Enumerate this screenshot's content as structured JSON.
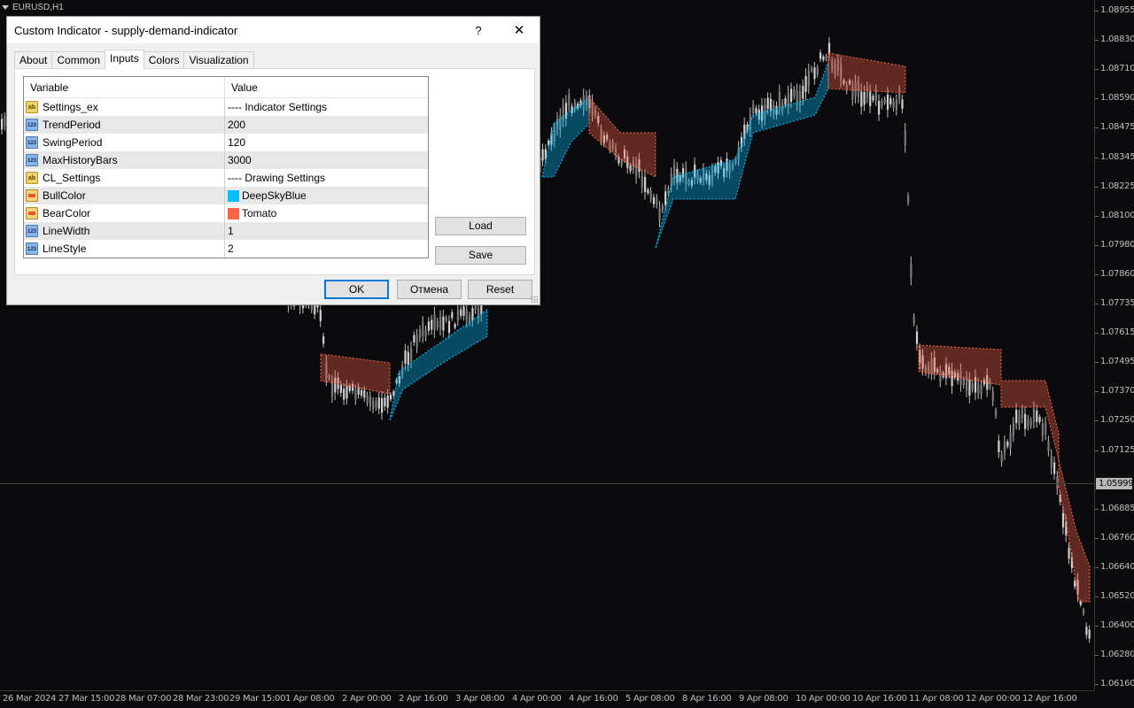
{
  "chart": {
    "symbol": "EURUSD,H1",
    "current_price": "1.05999",
    "price_labels": [
      "1.08955",
      "1.08830",
      "1.08710",
      "1.08590",
      "1.08475",
      "1.08345",
      "1.08225",
      "1.08100",
      "1.07980",
      "1.07860",
      "1.07735",
      "1.07615",
      "1.07495",
      "1.07370",
      "1.07250",
      "1.07125",
      "1.06885",
      "1.06760",
      "1.06640",
      "1.06520",
      "1.06400",
      "1.06280",
      "1.06160"
    ],
    "time_labels": [
      "26 Mar 2024",
      "27 Mar 15:00",
      "28 Mar 07:00",
      "28 Mar 23:00",
      "29 Mar 15:00",
      "1 Apr 08:00",
      "2 Apr 00:00",
      "2 Apr 16:00",
      "3 Apr 08:00",
      "4 Apr 00:00",
      "4 Apr 16:00",
      "5 Apr 08:00",
      "8 Apr 16:00",
      "9 Apr 08:00",
      "10 Apr 00:00",
      "10 Apr 16:00",
      "11 Apr 08:00",
      "12 Apr 00:00",
      "12 Apr 16:00"
    ],
    "colors": {
      "background": "#0b0b0e",
      "candle": "#bdbdbd",
      "bull_zone": "#00bfff",
      "bear_zone": "#ff6347"
    }
  },
  "dialog": {
    "title": "Custom Indicator - supply-demand-indicator",
    "help_label": "?",
    "close_label": "✕",
    "tabs": [
      "About",
      "Common",
      "Inputs",
      "Colors",
      "Visualization"
    ],
    "active_tab": "Inputs",
    "columns": {
      "variable": "Variable",
      "value": "Value"
    },
    "rows": [
      {
        "icon": "ab",
        "variable": "Settings_ex",
        "value": "---- Indicator Settings"
      },
      {
        "icon": "123",
        "variable": "TrendPeriod",
        "value": "200"
      },
      {
        "icon": "123",
        "variable": "SwingPeriod",
        "value": "120"
      },
      {
        "icon": "123",
        "variable": "MaxHistoryBars",
        "value": "3000"
      },
      {
        "icon": "ab",
        "variable": "CL_Settings",
        "value": "---- Drawing Settings"
      },
      {
        "icon": "color",
        "variable": "BullColor",
        "value": "DeepSkyBlue",
        "swatch": "#00bfff"
      },
      {
        "icon": "color",
        "variable": "BearColor",
        "value": "Tomato",
        "swatch": "#ff6347"
      },
      {
        "icon": "123",
        "variable": "LineWidth",
        "value": "1"
      },
      {
        "icon": "123",
        "variable": "LineStyle",
        "value": "2"
      }
    ],
    "load_label": "Load",
    "save_label": "Save",
    "ok_label": "OK",
    "cancel_label": "Отмена",
    "reset_label": "Reset"
  }
}
